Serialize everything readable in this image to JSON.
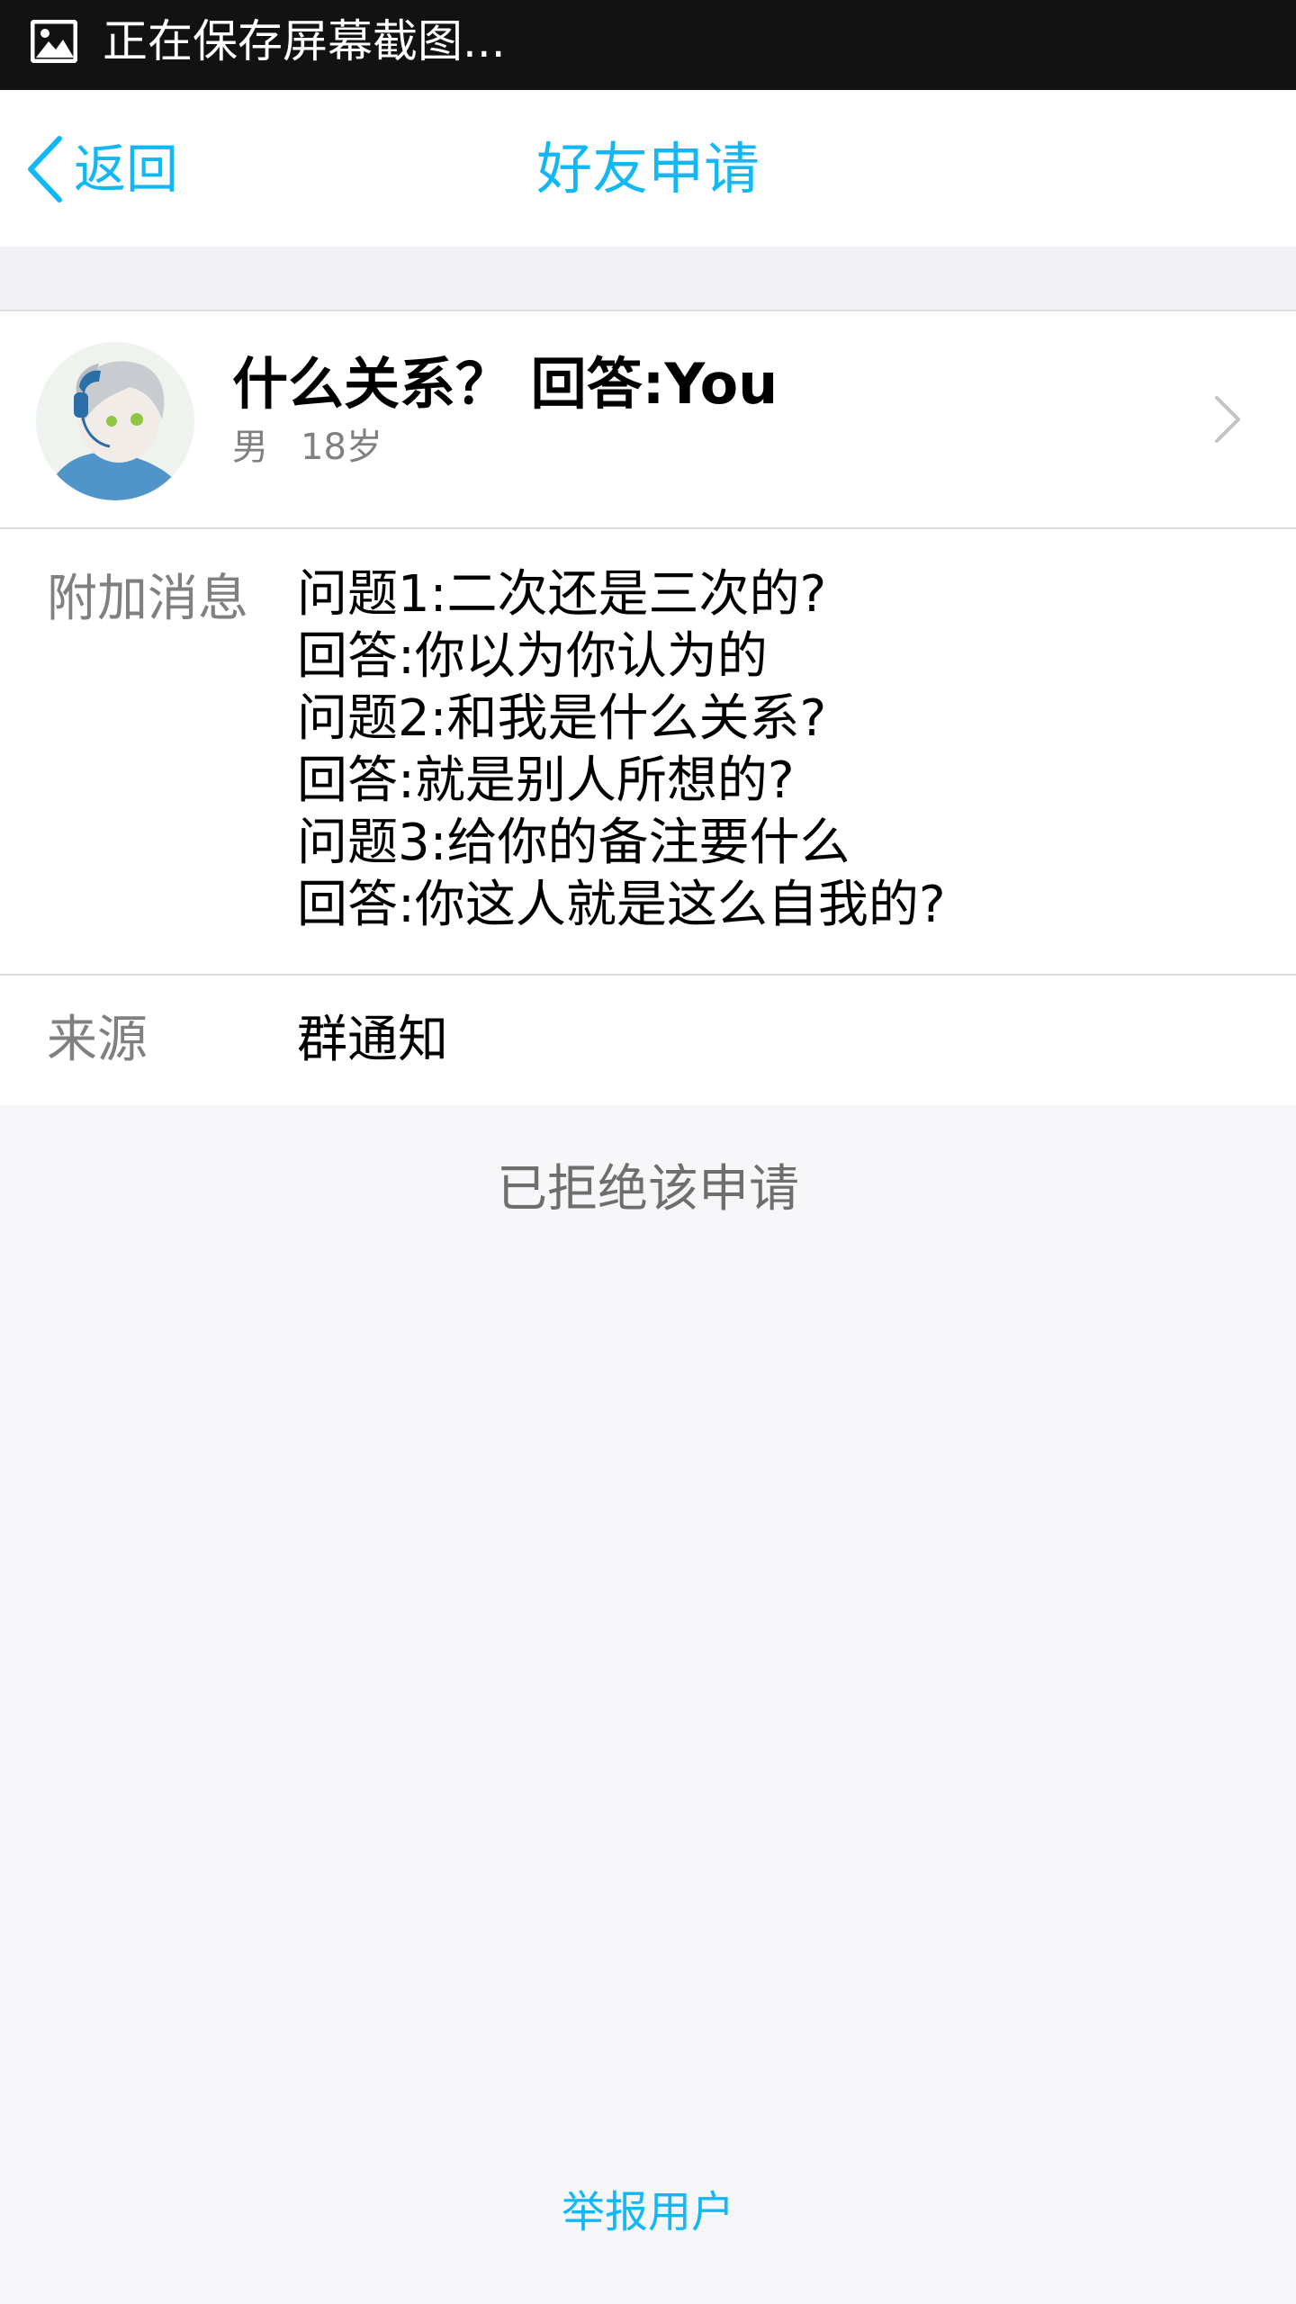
{
  "status_bar": {
    "icon": "image-icon",
    "text": "正在保存屏幕截图..."
  },
  "nav": {
    "back_label": "返回",
    "title": "好友申请"
  },
  "profile": {
    "name": "什么关系？ 回答:You",
    "gender": "男",
    "age": "18岁"
  },
  "message": {
    "label": "附加消息",
    "lines": [
      "问题1:二次还是三次的?",
      "回答:你以为你认为的",
      "问题2:和我是什么关系?",
      "回答:就是别人所想的?",
      "问题3:给你的备注要什么",
      "回答:你这人就是这么自我的?"
    ]
  },
  "source": {
    "label": "来源",
    "value": "群通知"
  },
  "status_message": "已拒绝该申请",
  "report_label": "举报用户",
  "colors": {
    "accent": "#12b7f5",
    "status_bar_bg": "#121212",
    "page_bg": "#f7f7f9"
  }
}
